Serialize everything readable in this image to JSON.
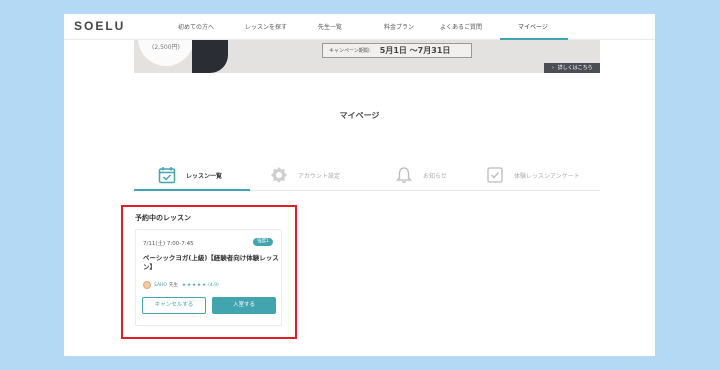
{
  "header": {
    "logo": "SOELU",
    "nav": [
      "初めての方へ",
      "レッスンを探す",
      "先生一覧",
      "料金プラン",
      "よくあるご質問",
      "マイページ"
    ],
    "active_nav_index": 5
  },
  "banner": {
    "price": "(2,500円)",
    "campaign_label": "キャンペーン期間：",
    "campaign_dates": "5月1日 〜7月31日",
    "details_button": "詳しくはこちら"
  },
  "page_title": "マイページ",
  "tabs": [
    {
      "label": "レッスン一覧",
      "icon": "calendar-check-icon",
      "active": true
    },
    {
      "label": "アカウント設定",
      "icon": "gear-icon",
      "active": false
    },
    {
      "label": "お知らせ",
      "icon": "bell-icon",
      "active": false
    },
    {
      "label": "体験レッスンアンケート",
      "icon": "checkbox-icon",
      "active": false
    }
  ],
  "reserved": {
    "title": "予約中のレッスン",
    "card": {
      "datetime": "7/11(土) 7:00-7:45",
      "badge": "強度1",
      "lesson_title": "ベーシックヨガ(上級)【経験者向け体験レッスン】",
      "teacher_name": "SAHO",
      "teacher_suffix": "先生",
      "stars": "★★★★★",
      "rating": "(4.9)",
      "cancel_label": "キャンセルする",
      "enter_label": "入室する"
    }
  },
  "colors": {
    "accent": "#42a4ae",
    "highlight_border": "#dd1f26",
    "background": "#b3d9f5"
  }
}
